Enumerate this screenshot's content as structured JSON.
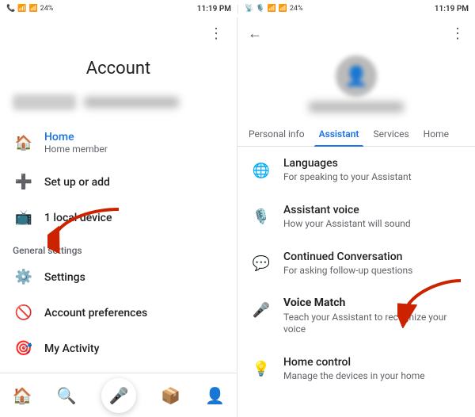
{
  "statusBar": {
    "leftIcons": "📶",
    "leftTime": "11:19 PM",
    "leftBattery": "24%",
    "rightTime": "11:19 PM",
    "rightBattery": "24%"
  },
  "leftPanel": {
    "moreMenuLabel": "⋮",
    "title": "Account",
    "navItems": [
      {
        "icon": "🏠",
        "label": "Home",
        "sub": "Home member",
        "active": true
      },
      {
        "icon": "➕",
        "label": "Set up or add",
        "sub": "",
        "active": false
      },
      {
        "icon": "📺",
        "label": "1 local device",
        "sub": "",
        "active": false
      }
    ],
    "sectionHeader": "General settings",
    "generalItems": [
      {
        "icon": "⚙️",
        "label": "Settings",
        "sub": ""
      },
      {
        "icon": "🚫",
        "label": "Account preferences",
        "sub": ""
      },
      {
        "icon": "🎯",
        "label": "My Activity",
        "sub": ""
      }
    ],
    "bottomNav": [
      {
        "icon": "🏠",
        "label": ""
      },
      {
        "icon": "🔍",
        "label": ""
      },
      {
        "icon": "📦",
        "label": ""
      },
      {
        "icon": "👤",
        "label": ""
      }
    ],
    "micIcon": "🎤"
  },
  "rightPanel": {
    "backIcon": "←",
    "moreIcon": "⋮",
    "tabs": [
      {
        "label": "Personal info",
        "active": false
      },
      {
        "label": "Assistant",
        "active": true
      },
      {
        "label": "Services",
        "active": false
      },
      {
        "label": "Home",
        "active": false
      }
    ],
    "settingsItems": [
      {
        "icon": "🌐",
        "label": "Languages",
        "sub": "For speaking to your Assistant"
      },
      {
        "icon": "🎙️",
        "label": "Assistant voice",
        "sub": "How your Assistant will sound"
      },
      {
        "icon": "💬",
        "label": "Continued Conversation",
        "sub": "For asking follow-up questions"
      },
      {
        "icon": "🎤",
        "label": "Voice Match",
        "sub": "Teach your Assistant to recognize your voice"
      },
      {
        "icon": "💡",
        "label": "Home control",
        "sub": "Manage the devices in your home"
      }
    ]
  }
}
